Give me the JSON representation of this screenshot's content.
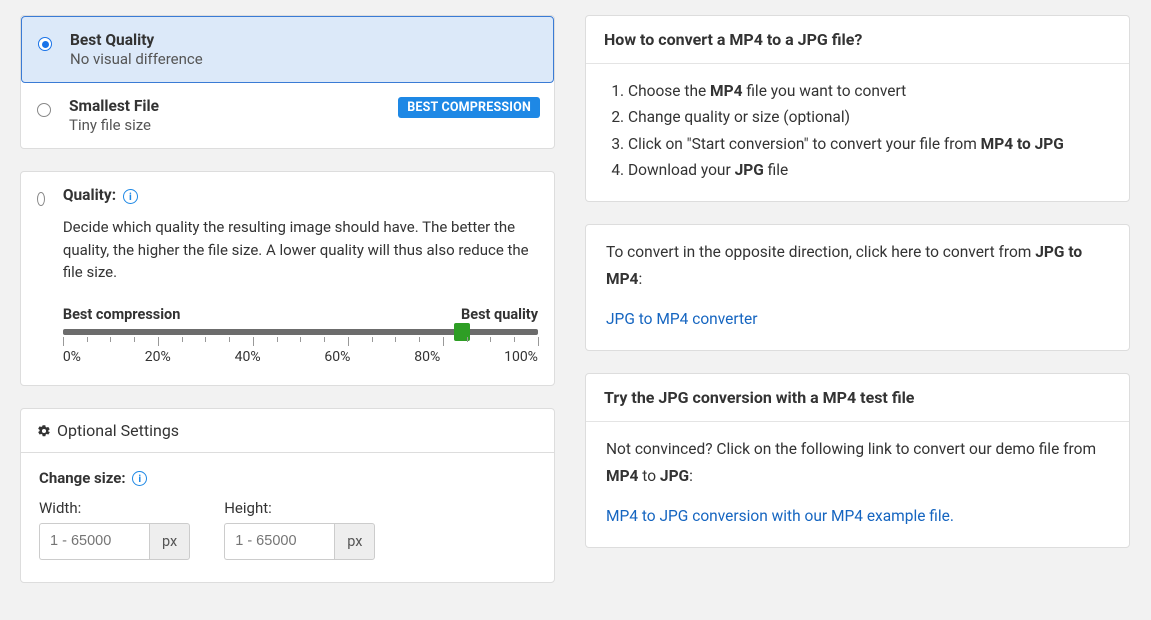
{
  "options": {
    "best_quality": {
      "title": "Best Quality",
      "sub": "No visual difference"
    },
    "smallest": {
      "title": "Smallest File",
      "sub": "Tiny file size",
      "badge": "BEST COMPRESSION"
    }
  },
  "quality": {
    "label": "Quality:",
    "desc": "Decide which quality the resulting image should have. The better the quality, the higher the file size. A lower quality will thus also reduce the file size.",
    "left_label": "Best compression",
    "right_label": "Best quality",
    "value_percent": 84,
    "ticks": [
      "0%",
      "20%",
      "40%",
      "60%",
      "80%",
      "100%"
    ]
  },
  "settings": {
    "header": "Optional Settings",
    "change_size_label": "Change size:",
    "width_label": "Width:",
    "height_label": "Height:",
    "placeholder": "1 - 65000",
    "unit": "px"
  },
  "howto": {
    "title": "How to convert a MP4 to a JPG file?",
    "step1_a": "Choose the ",
    "step1_b": "MP4",
    "step1_c": " file you want to convert",
    "step2": "Change quality or size (optional)",
    "step3_a": "Click on \"Start conversion\" to convert your file from ",
    "step3_b": "MP4 to JPG",
    "step4_a": "Download your ",
    "step4_b": "JPG",
    "step4_c": " file"
  },
  "opposite": {
    "text_a": "To convert in the opposite direction, click here to convert from ",
    "text_b": "JPG to MP4",
    "text_c": ":",
    "link": "JPG to MP4 converter"
  },
  "testfile": {
    "title": "Try the JPG conversion with a MP4 test file",
    "text_a": "Not convinced? Click on the following link to convert our demo file from ",
    "text_b": "MP4",
    "text_c": " to ",
    "text_d": "JPG",
    "text_e": ":",
    "link": "MP4 to JPG conversion with our MP4 example file."
  }
}
